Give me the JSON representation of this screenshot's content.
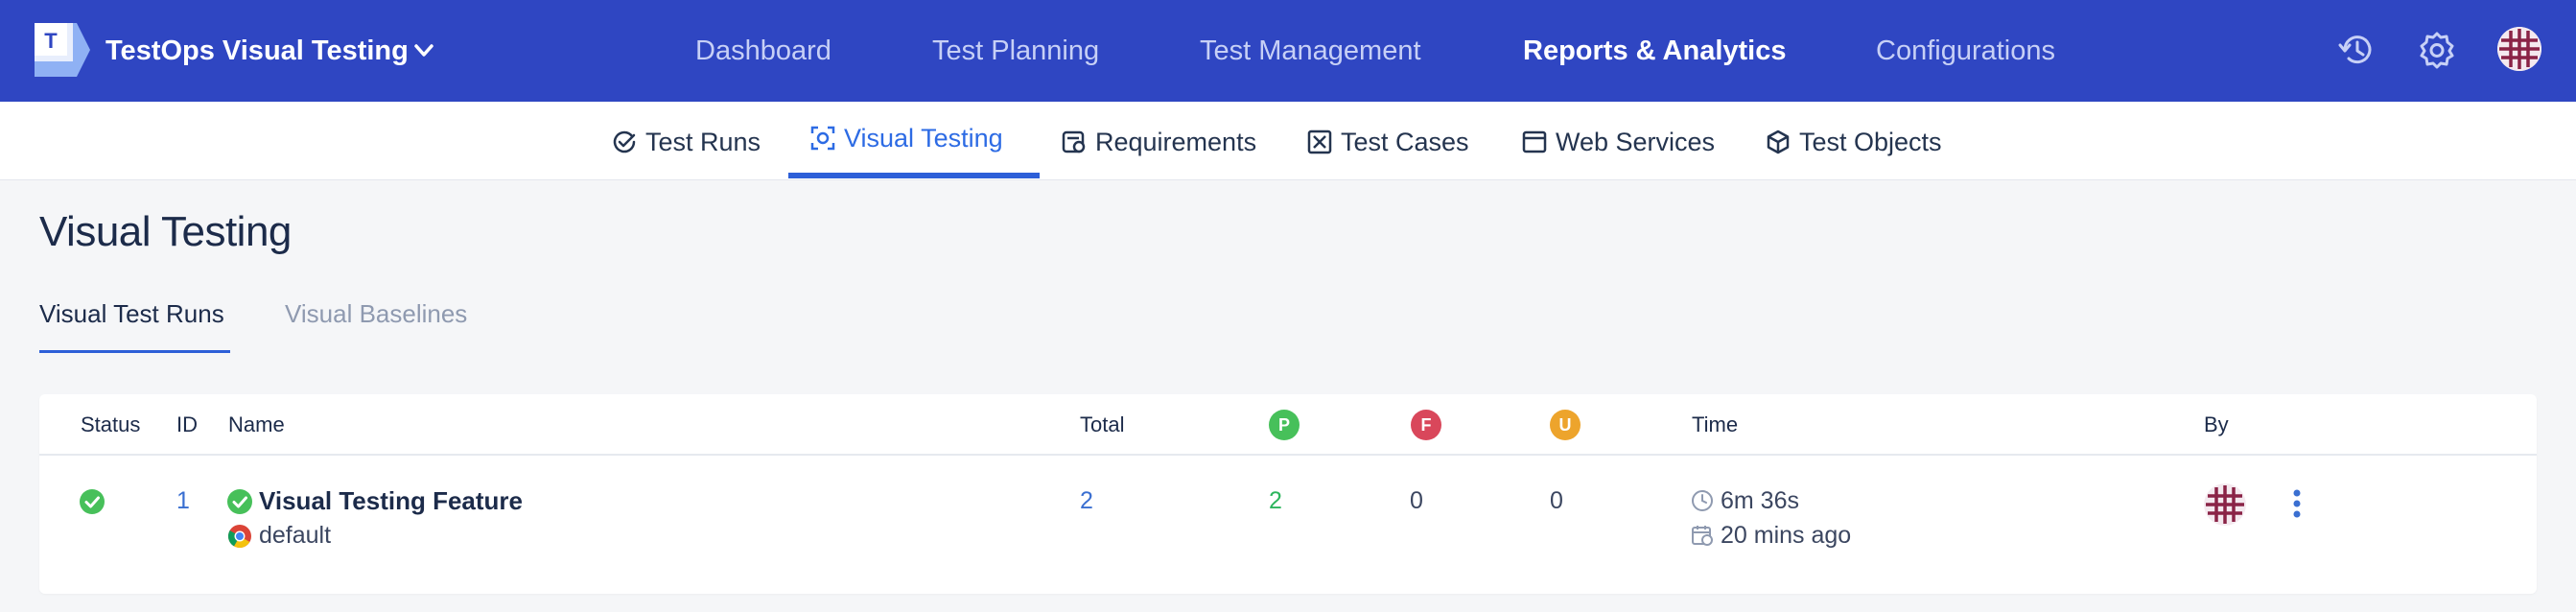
{
  "header": {
    "app_title": "TestOps Visual Testing",
    "nav": [
      {
        "label": "Dashboard",
        "active": false
      },
      {
        "label": "Test Planning",
        "active": false
      },
      {
        "label": "Test Management",
        "active": false
      },
      {
        "label": "Reports & Analytics",
        "active": true
      },
      {
        "label": "Configurations",
        "active": false
      }
    ],
    "icons": [
      "history-icon",
      "settings-icon",
      "user-avatar"
    ]
  },
  "subnav": {
    "items": [
      {
        "label": "Test Runs",
        "icon": "check-circle-icon",
        "active": false
      },
      {
        "label": "Visual Testing",
        "icon": "camera-focus-icon",
        "active": true
      },
      {
        "label": "Requirements",
        "icon": "requirements-icon",
        "active": false
      },
      {
        "label": "Test Cases",
        "icon": "test-cases-icon",
        "active": false
      },
      {
        "label": "Web Services",
        "icon": "window-icon",
        "active": false
      },
      {
        "label": "Test Objects",
        "icon": "cube-icon",
        "active": false
      }
    ]
  },
  "page": {
    "title": "Visual Testing",
    "tabs": [
      {
        "label": "Visual Test Runs",
        "active": true
      },
      {
        "label": "Visual Baselines",
        "active": false
      }
    ]
  },
  "table": {
    "columns": {
      "status": "Status",
      "id": "ID",
      "name": "Name",
      "total": "Total",
      "passed": "P",
      "failed": "F",
      "unresolved": "U",
      "time": "Time",
      "by": "By"
    },
    "rows": [
      {
        "status": "passed",
        "id": "1",
        "name": "Visual Testing Feature",
        "browser": "default",
        "total": "2",
        "passed": "2",
        "failed": "0",
        "unresolved": "0",
        "duration": "6m 36s",
        "started": "20 mins ago"
      }
    ]
  },
  "colors": {
    "topbar": "#2f46c2",
    "accent": "#2d5fd8",
    "passed": "#47c05a",
    "failed": "#d9475b",
    "unresolved": "#eda42c"
  }
}
